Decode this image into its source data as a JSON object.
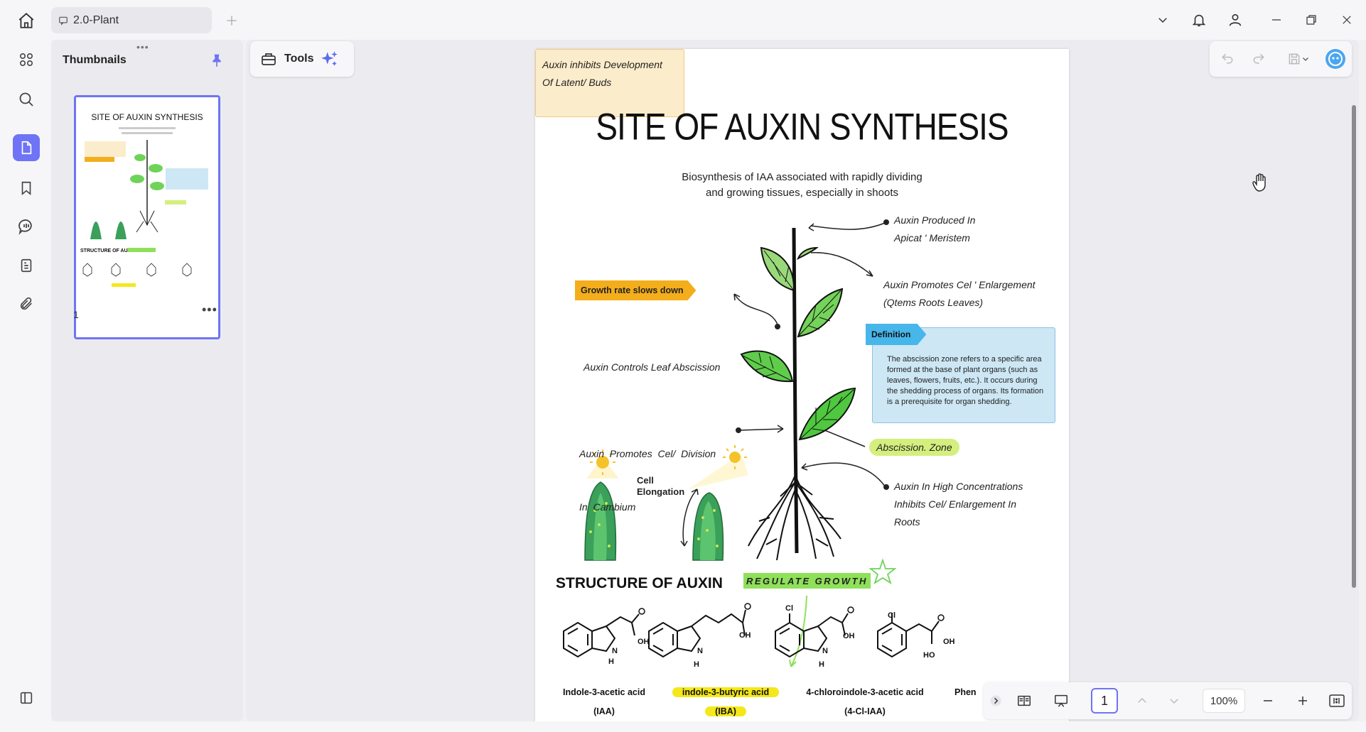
{
  "tab": {
    "title": "2.0-Plant"
  },
  "thumbnails": {
    "title": "Thumbnails",
    "page_number": "1"
  },
  "toolbar": {
    "tools_label": "Tools"
  },
  "page": {
    "title": "SITE OF AUXIN SYNTHESIS",
    "subtitle_line1": "Biosynthesis of IAA associated with rapidly dividing",
    "subtitle_line2": "and growing tissues, especially in shoots",
    "inhibits_line1": "Auxin inhibits Development",
    "inhibits_line2": "Of Latent/ Buds",
    "growth_tag": "Growth rate slows down",
    "controls_abscission": "Auxin Controls Leaf Abscission",
    "division_line1": "Auxin  Promotes  Cel/  Division",
    "division_line2": "In  Cambium",
    "produced_line1": "Auxin Produced In",
    "produced_line2": "Apicat ' Meristem",
    "enlargement_line1": "Auxin Promotes Cel ' Enlargement",
    "enlargement_line2": "(Qtems Roots Leaves)",
    "definition_tag": "Definition",
    "definition_text": "The abscission zone refers to a specific area formed at the base of plant organs (such as leaves, flowers, fruits, etc.). It occurs during the shedding process of organs. Its formation is a prerequisite for organ shedding.",
    "abscission_zone": "Abscission. Zone",
    "high_conc_line1": "Auxin In High Concentrations",
    "high_conc_line2": "Inhibits Cel/ Enlargement In",
    "high_conc_line3": "Roots",
    "cell_elongation_line1": "Cell",
    "cell_elongation_line2": "Elongation",
    "structure_title": "STRUCTURE OF AUXIN",
    "regulate_tag": "REGULATE GROWTH",
    "chemicals": [
      {
        "name": "Indole-3-acetic acid",
        "abbr": "(IAA)"
      },
      {
        "name": "indole-3-butyric acid",
        "abbr": "(IBA)"
      },
      {
        "name": "4-chloroindole-3-acetic acid",
        "abbr": "(4-Cl-IAA)"
      },
      {
        "name": "Phen",
        "abbr": ""
      }
    ],
    "chem_labels": {
      "oh": "OH",
      "ho": "HO",
      "n": "N",
      "h": "H",
      "cl": "Cl"
    }
  },
  "thumb_text": {
    "title": "SITE OF AUXIN SYNTHESIS",
    "structure": "STRUCTURE OF AUXIN"
  },
  "bottom_bar": {
    "page_input": "1",
    "zoom": "100%"
  },
  "colors": {
    "accent": "#6e74f5",
    "growth_tag": "#f4ae1b",
    "definition_tag": "#47b6ea",
    "highlight": "#f4e81a",
    "leaf_green": "#6fd35a"
  }
}
